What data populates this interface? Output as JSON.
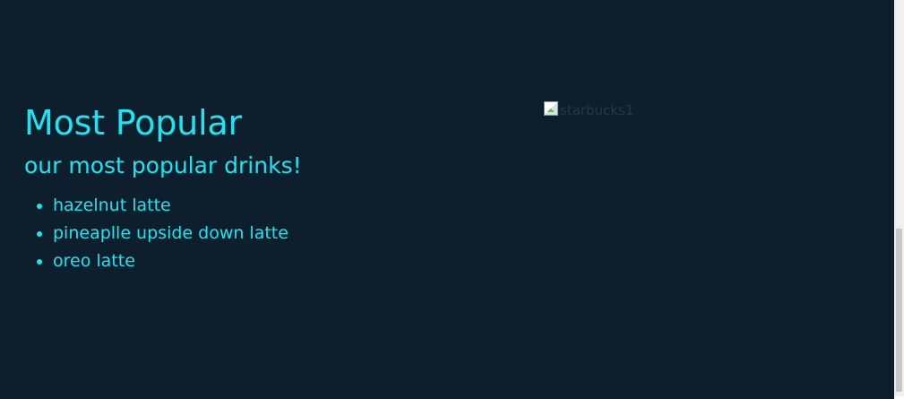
{
  "section": {
    "title": "Most Popular",
    "subtitle": "our most popular drinks!",
    "drinks": [
      "hazelnut latte",
      "pineaplle upside down latte",
      "oreo latte"
    ]
  },
  "image": {
    "alt": "starbucks1",
    "icon": "broken-image-icon"
  },
  "colors": {
    "background": "#0d1f2d",
    "accent": "#19e6f2"
  },
  "scrollbar": {
    "position_fraction": 0.57
  }
}
